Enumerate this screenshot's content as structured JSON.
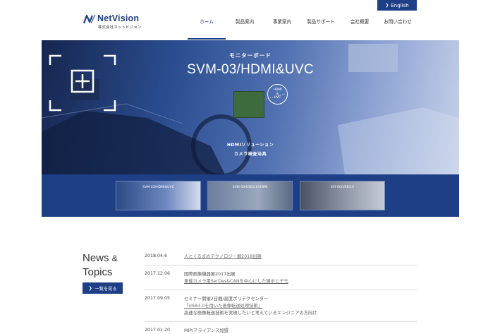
{
  "header": {
    "lang_button": "English",
    "logo_name": "NetVision",
    "logo_sub": "株式会社ネットビジョン",
    "brand_color": "#1e3f85"
  },
  "nav": {
    "items": [
      {
        "label": "ホーム",
        "active": true
      },
      {
        "label": "製品案内",
        "active": false
      },
      {
        "label": "事業案内",
        "active": false
      },
      {
        "label": "製品サポート",
        "active": false
      },
      {
        "label": "会社概要",
        "active": false
      },
      {
        "label": "お問い合わせ",
        "active": false
      }
    ]
  },
  "hero": {
    "subtitle": "モニターボード",
    "title": "SVM-03/HDMI&UVC",
    "badge_line1": "HDMI",
    "badge_line2": "&",
    "badge_line3": "UVC",
    "caption1": "HDMIソリューション",
    "caption2": "カメラ検査治具",
    "thumbs": [
      {
        "label": "SVM-03/HDMI&UVC"
      },
      {
        "label": "SVM-03/USB3.0/HDMI"
      },
      {
        "label": "SVI-06/USB3.0"
      }
    ]
  },
  "news": {
    "title_line1": "News",
    "title_amp": "&",
    "title_line2": "Topics",
    "more_button": "一覧を見る",
    "items": [
      {
        "date": "2018.04.6",
        "lines": [
          {
            "text": "人とくるまのテクノロジー展2018出展",
            "link": true
          }
        ]
      },
      {
        "date": "2017.12.06",
        "lines": [
          {
            "text": "国際画像機器展2017出展",
            "link": false
          },
          {
            "text": "車載カメラ用SerDes&CANを中心にした展示とデモ",
            "link": true
          }
        ]
      },
      {
        "date": "2017.09.05",
        "lines": [
          {
            "text": "セミナー開催2日間/高度ポリテクセンター",
            "link": false
          },
          {
            "text": "「USB3.0を用いた画像転送処理技術」",
            "link": true
          },
          {
            "text": "高速な画像転送技術を実現したいと考えているエンジニアの方向け",
            "link": false
          }
        ]
      },
      {
        "date": "2017.01.20",
        "lines": [
          {
            "text": "MIPIアライアンス加盟",
            "link": false
          }
        ]
      }
    ]
  }
}
